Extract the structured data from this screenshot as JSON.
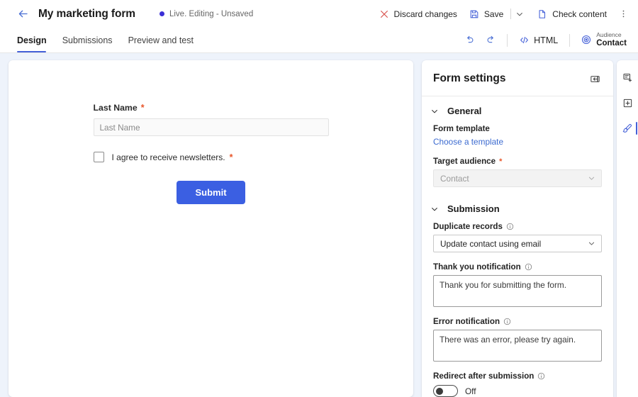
{
  "topbar": {
    "back_icon": "back-arrow-icon",
    "title": "My marketing form",
    "status": "Live. Editing - Unsaved",
    "status_dot_color": "#3b2fd6",
    "discard_label": "Discard changes",
    "discard_icon": "close-x-icon",
    "save_label": "Save",
    "save_icon": "save-disk-icon",
    "save_chevron_icon": "chevron-down-icon",
    "check_content_label": "Check content",
    "check_content_icon": "document-icon",
    "overflow_icon": "more-vertical-icon"
  },
  "tabbar": {
    "tabs": [
      {
        "label": "Design",
        "active": true
      },
      {
        "label": "Submissions",
        "active": false
      },
      {
        "label": "Preview and test",
        "active": false
      }
    ],
    "undo_icon": "undo-arrow-icon",
    "redo_icon": "redo-arrow-icon",
    "html_label": "HTML",
    "html_icon": "code-brackets-icon",
    "audience_icon": "target-audience-icon",
    "audience_label": "Audience",
    "audience_value": "Contact"
  },
  "form": {
    "fields": [
      {
        "label": "Last Name",
        "required": true,
        "required_mark": "*",
        "placeholder": "Last Name",
        "value": ""
      }
    ],
    "consent": {
      "label": "I agree to receive newsletters.",
      "required_mark": "*",
      "checked": false
    },
    "submit_label": "Submit",
    "submit_color": "#3b5fe2"
  },
  "settings": {
    "title": "Form settings",
    "collapse_icon": "collapse-panel-icon",
    "sections": [
      {
        "title": "General",
        "chevron_icon": "chevron-down-icon",
        "expanded": true,
        "form_template_label": "Form template",
        "choose_template_link": "Choose a template",
        "target_audience_label": "Target audience",
        "target_audience_required": "*",
        "target_audience_value": "Contact",
        "target_audience_disabled": true
      },
      {
        "title": "Submission",
        "chevron_icon": "chevron-down-icon",
        "expanded": true,
        "duplicate_records_label": "Duplicate records",
        "duplicate_records_value": "Update contact using email",
        "thank_you_label": "Thank you notification",
        "thank_you_value": "Thank you for submitting the form.",
        "error_label": "Error notification",
        "error_value": "There was an error, please try again.",
        "redirect_label": "Redirect after submission",
        "redirect_state": "Off",
        "redirect_on": false,
        "info_icon": "info-circle-icon"
      }
    ]
  },
  "rail": {
    "items": [
      {
        "icon": "add-element-icon",
        "name": "add-element",
        "active": false
      },
      {
        "icon": "add-section-icon",
        "name": "add-section",
        "active": false
      },
      {
        "icon": "style-brush-icon",
        "name": "styles",
        "active": true
      }
    ]
  }
}
